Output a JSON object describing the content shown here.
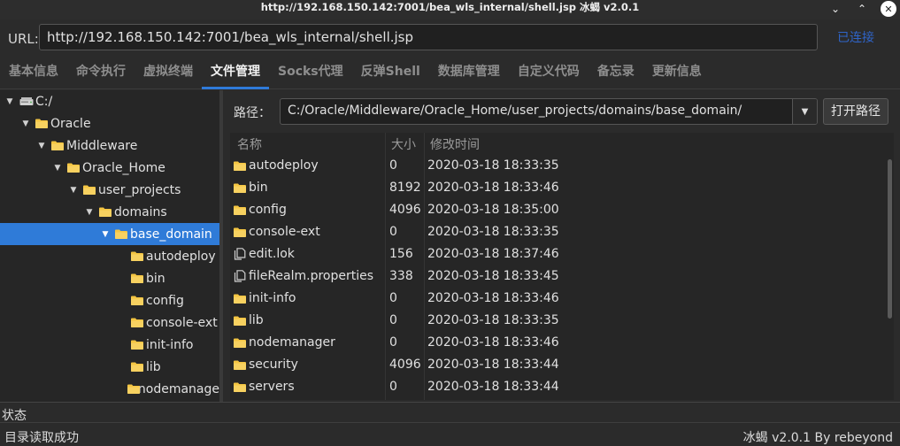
{
  "window": {
    "title": "http://192.168.150.142:7001/bea_wls_internal/shell.jsp  冰蝎 v2.0.1",
    "minimize_glyph": "⌄",
    "maximize_glyph": "⌃",
    "close_glyph": "✕"
  },
  "urlbar": {
    "label": "URL:",
    "value": "http://192.168.150.142:7001/bea_wls_internal/shell.jsp",
    "status": "已连接"
  },
  "tabs": [
    {
      "label": "基本信息"
    },
    {
      "label": "命令执行"
    },
    {
      "label": "虚拟终端"
    },
    {
      "label": "文件管理",
      "active": true
    },
    {
      "label": "Socks代理"
    },
    {
      "label": "反弹Shell"
    },
    {
      "label": "数据库管理"
    },
    {
      "label": "自定义代码"
    },
    {
      "label": "备忘录"
    },
    {
      "label": "更新信息"
    }
  ],
  "tree": {
    "items": [
      {
        "label": "C:/",
        "type": "drive",
        "level": 0,
        "expanded": true
      },
      {
        "label": "Oracle",
        "type": "folder",
        "level": 1,
        "expanded": true
      },
      {
        "label": "Middleware",
        "type": "folder",
        "level": 2,
        "expanded": true
      },
      {
        "label": "Oracle_Home",
        "type": "folder",
        "level": 3,
        "expanded": true
      },
      {
        "label": "user_projects",
        "type": "folder",
        "level": 4,
        "expanded": true
      },
      {
        "label": "domains",
        "type": "folder",
        "level": 5,
        "expanded": true
      },
      {
        "label": "base_domain",
        "type": "folder",
        "level": 6,
        "expanded": true,
        "selected": true
      },
      {
        "label": "autodeploy",
        "type": "folder",
        "level": 7
      },
      {
        "label": "bin",
        "type": "folder",
        "level": 7
      },
      {
        "label": "config",
        "type": "folder",
        "level": 7
      },
      {
        "label": "console-ext",
        "type": "folder",
        "level": 7
      },
      {
        "label": "init-info",
        "type": "folder",
        "level": 7
      },
      {
        "label": "lib",
        "type": "folder",
        "level": 7
      },
      {
        "label": "nodemanage",
        "type": "folder",
        "level": 7
      }
    ]
  },
  "filepanel": {
    "path_label": "路径：",
    "path_value": "C:/Oracle/Middleware/Oracle_Home/user_projects/domains/base_domain/",
    "open_button": "打开路径",
    "columns": [
      "名称",
      "大小",
      "修改时间"
    ],
    "rows": [
      {
        "name": "autodeploy",
        "type": "folder",
        "size": "0",
        "modified": "2020-03-18 18:33:35"
      },
      {
        "name": "bin",
        "type": "folder",
        "size": "8192",
        "modified": "2020-03-18 18:33:46"
      },
      {
        "name": "config",
        "type": "folder",
        "size": "4096",
        "modified": "2020-03-18 18:35:00"
      },
      {
        "name": "console-ext",
        "type": "folder",
        "size": "0",
        "modified": "2020-03-18 18:33:35"
      },
      {
        "name": "edit.lok",
        "type": "file",
        "size": "156",
        "modified": "2020-03-18 18:37:46"
      },
      {
        "name": "fileRealm.properties",
        "type": "file",
        "size": "338",
        "modified": "2020-03-18 18:33:45"
      },
      {
        "name": "init-info",
        "type": "folder",
        "size": "0",
        "modified": "2020-03-18 18:33:46"
      },
      {
        "name": "lib",
        "type": "folder",
        "size": "0",
        "modified": "2020-03-18 18:33:35"
      },
      {
        "name": "nodemanager",
        "type": "folder",
        "size": "0",
        "modified": "2020-03-18 18:33:46"
      },
      {
        "name": "security",
        "type": "folder",
        "size": "4096",
        "modified": "2020-03-18 18:33:44"
      },
      {
        "name": "servers",
        "type": "folder",
        "size": "0",
        "modified": "2020-03-18 18:33:44"
      }
    ]
  },
  "status": {
    "title": "状态",
    "message": "目录读取成功",
    "version": "冰蝎 v2.0.1   By rebeyond"
  },
  "colors": {
    "accent": "#2f7bd8",
    "folder": "#f4c542",
    "connected_text": "#2f64c8"
  }
}
